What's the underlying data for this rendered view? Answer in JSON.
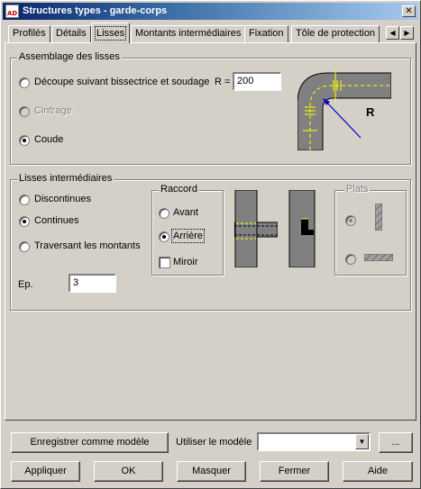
{
  "window": {
    "title": "Structures types - garde-corps",
    "app_icon_text": "AD",
    "close_glyph": "✕"
  },
  "tabs": [
    {
      "label": "Profilés",
      "active": false
    },
    {
      "label": "Détails",
      "active": false
    },
    {
      "label": "Lisses",
      "active": true
    },
    {
      "label": "Montants intermédiaires",
      "active": false
    },
    {
      "label": "Fixation",
      "active": false
    },
    {
      "label": "Tôle de protection",
      "active": false
    }
  ],
  "tab_scroll": {
    "left_glyph": "◀",
    "right_glyph": "▶"
  },
  "assemblage": {
    "title": "Assemblage des lisses",
    "options": [
      {
        "label": "Découpe suivant bissectrice et soudage",
        "checked": false,
        "disabled": false
      },
      {
        "label": "Cintrage",
        "checked": false,
        "disabled": true
      },
      {
        "label": "Coude",
        "checked": true,
        "disabled": false
      }
    ],
    "r_label": "R =",
    "r_value": "200",
    "diagram_label": "R"
  },
  "intermediaires": {
    "title": "Lisses intermédiaires",
    "options": [
      {
        "label": "Discontinues",
        "checked": false
      },
      {
        "label": "Continues",
        "checked": true
      },
      {
        "label": "Traversant les montants",
        "checked": false
      }
    ],
    "ep_label": "Ep.",
    "ep_value": "3",
    "raccord": {
      "title": "Raccord",
      "options": [
        {
          "label": "Avant",
          "checked": false
        },
        {
          "label": "Arrière",
          "checked": true
        }
      ],
      "miroir_label": "Miroir",
      "miroir_checked": false
    },
    "plats": {
      "title": "Plats",
      "disabled": true,
      "option1_checked": true,
      "option2_checked": false
    }
  },
  "model": {
    "save_label": "Enregistrer comme modèle",
    "use_label": "Utiliser le modèle",
    "combo_value": "",
    "combo_arrow": "▼",
    "browse_label": "..."
  },
  "footer": {
    "apply": "Appliquer",
    "ok": "OK",
    "hide": "Masquer",
    "close": "Fermer",
    "help": "Aide"
  },
  "colors": {
    "face": "#d4d0c8",
    "title_gradient_start": "#0a246a",
    "profile_fill": "#808080",
    "weld_mark": "#ffff00",
    "radius_arrow": "#0000cc"
  }
}
